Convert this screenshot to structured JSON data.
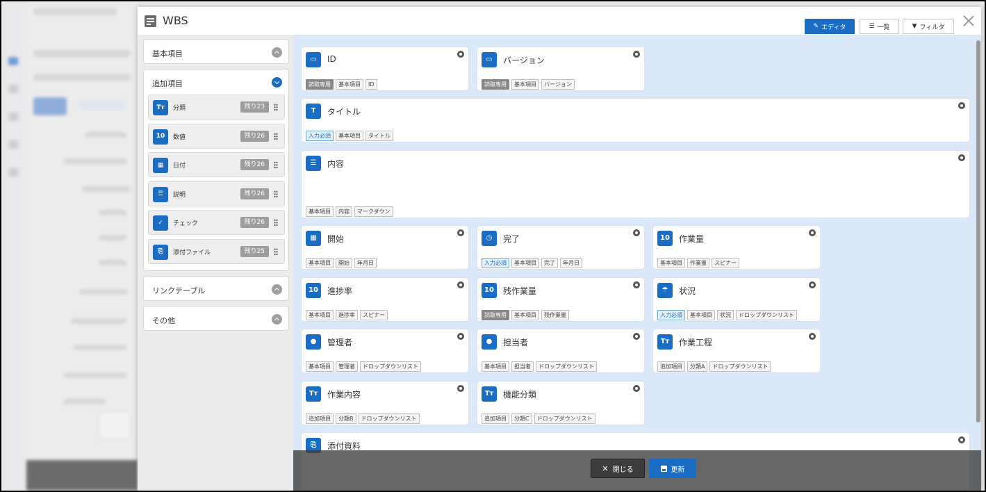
{
  "dialog": {
    "title": "WBS",
    "tabs": [
      {
        "label": "エディタ",
        "icon": "edit-icon",
        "active": true
      },
      {
        "label": "一覧",
        "icon": "list-icon",
        "active": false
      },
      {
        "label": "フィルタ",
        "icon": "filter-icon",
        "active": false
      }
    ]
  },
  "sidebar": {
    "basic": {
      "title": "基本項目"
    },
    "extra": {
      "title": "追加項目",
      "items": [
        {
          "icon": "Tт",
          "label": "分類",
          "count": "残り23"
        },
        {
          "icon": "10",
          "label": "数値",
          "count": "残り26"
        },
        {
          "icon": "date",
          "label": "日付",
          "count": "残り26"
        },
        {
          "icon": "desc",
          "label": "説明",
          "count": "残り26"
        },
        {
          "icon": "check",
          "label": "チェック",
          "count": "残り26"
        },
        {
          "icon": "clip",
          "label": "添付ファイル",
          "count": "残り25"
        }
      ]
    },
    "link": {
      "title": "リンクテーブル"
    },
    "other": {
      "title": "その他"
    }
  },
  "cards": [
    {
      "title": "ID",
      "icon": "id",
      "tags": [
        [
          "読取専用",
          "ro"
        ],
        [
          "基本項目",
          ""
        ],
        [
          "ID",
          ""
        ]
      ]
    },
    {
      "title": "バージョン",
      "icon": "id",
      "tags": [
        [
          "読取専用",
          "ro"
        ],
        [
          "基本項目",
          ""
        ],
        [
          "バージョン",
          ""
        ]
      ]
    },
    {
      "title": "タイトル",
      "icon": "T",
      "tags": [
        [
          "入力必須",
          "req"
        ],
        [
          "基本項目",
          ""
        ],
        [
          "タイトル",
          ""
        ]
      ]
    },
    {
      "title": "内容",
      "icon": "desc",
      "tags": [
        [
          "基本項目",
          ""
        ],
        [
          "内容",
          ""
        ],
        [
          "マークダウン",
          ""
        ]
      ]
    },
    {
      "title": "開始",
      "icon": "date",
      "tags": [
        [
          "基本項目",
          ""
        ],
        [
          "開始",
          ""
        ],
        [
          "年月日",
          ""
        ]
      ]
    },
    {
      "title": "完了",
      "icon": "clock",
      "tags": [
        [
          "入力必須",
          "req"
        ],
        [
          "基本項目",
          ""
        ],
        [
          "完了",
          ""
        ],
        [
          "年月日",
          ""
        ]
      ]
    },
    {
      "title": "作業量",
      "icon": "10",
      "tags": [
        [
          "基本項目",
          ""
        ],
        [
          "作業量",
          ""
        ],
        [
          "スピナー",
          ""
        ]
      ]
    },
    {
      "title": "進捗率",
      "icon": "10",
      "tags": [
        [
          "基本項目",
          ""
        ],
        [
          "進捗率",
          ""
        ],
        [
          "スピナー",
          ""
        ]
      ]
    },
    {
      "title": "残作業量",
      "icon": "10",
      "tags": [
        [
          "読取専用",
          "ro"
        ],
        [
          "基本項目",
          ""
        ],
        [
          "残作業量",
          ""
        ]
      ]
    },
    {
      "title": "状況",
      "icon": "status",
      "tags": [
        [
          "入力必須",
          "req"
        ],
        [
          "基本項目",
          ""
        ],
        [
          "状況",
          ""
        ],
        [
          "ドロップダウンリスト",
          ""
        ]
      ]
    },
    {
      "title": "管理者",
      "icon": "user",
      "tags": [
        [
          "基本項目",
          ""
        ],
        [
          "管理者",
          ""
        ],
        [
          "ドロップダウンリスト",
          ""
        ]
      ]
    },
    {
      "title": "担当者",
      "icon": "user",
      "tags": [
        [
          "基本項目",
          ""
        ],
        [
          "担当者",
          ""
        ],
        [
          "ドロップダウンリスト",
          ""
        ]
      ]
    },
    {
      "title": "作業工程",
      "icon": "Tт",
      "tags": [
        [
          "追加項目",
          ""
        ],
        [
          "分類A",
          ""
        ],
        [
          "ドロップダウンリスト",
          ""
        ]
      ]
    },
    {
      "title": "作業内容",
      "icon": "Tт",
      "tags": [
        [
          "追加項目",
          ""
        ],
        [
          "分類B",
          ""
        ],
        [
          "ドロップダウンリスト",
          ""
        ]
      ]
    },
    {
      "title": "機能分類",
      "icon": "Tт",
      "tags": [
        [
          "追加項目",
          ""
        ],
        [
          "分類C",
          ""
        ],
        [
          "ドロップダウンリスト",
          ""
        ]
      ]
    },
    {
      "title": "添付資料",
      "icon": "clip",
      "tags": []
    }
  ],
  "footer": {
    "close_label": "閉じる",
    "save_label": "更新"
  }
}
